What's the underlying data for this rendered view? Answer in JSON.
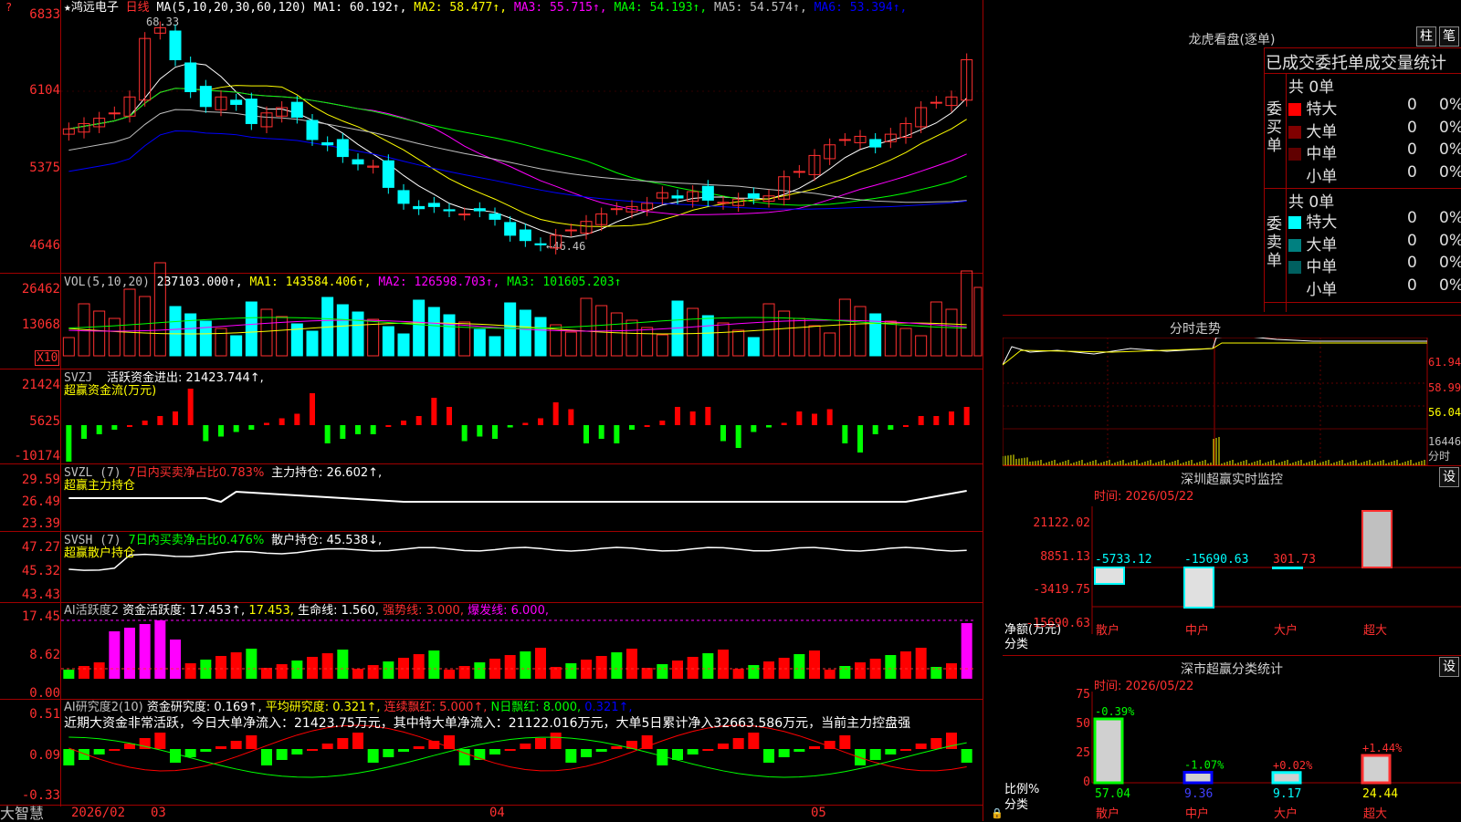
{
  "stock": {
    "name": "鸿远电子",
    "period": "日线",
    "star": "★"
  },
  "topbar": {
    "ma_label": "MA(5,10,20,30,60,120)",
    "ma": [
      {
        "name": "MA1:",
        "value": "60.192↑",
        "color": "#ffffff"
      },
      {
        "name": "MA2:",
        "value": "58.477↑",
        "color": "#ffff00"
      },
      {
        "name": "MA3:",
        "value": "55.715↑",
        "color": "#ff00ff"
      },
      {
        "name": "MA4:",
        "value": "54.193↑",
        "color": "#00ff00"
      },
      {
        "name": "MA5:",
        "value": "54.574↑",
        "color": "#c0c0c0"
      },
      {
        "name": "MA6:",
        "value": "53.394↑",
        "color": "#0000ff"
      }
    ]
  },
  "price_axis": [
    "6833",
    "6104",
    "5375",
    "4646"
  ],
  "price_marks": {
    "high": "68.33",
    "low": "46.46"
  },
  "vol_panel": {
    "label": "VOL(5,10,20)",
    "value": "237103.000↑,",
    "ma1": "MA1: 143584.406↑,",
    "ma2": "MA2: 126598.703↑,",
    "ma3": "MA3: 101605.203↑",
    "axis": [
      "26462",
      "13068"
    ],
    "unit": "X10"
  },
  "svzj": {
    "label": "SVZJ",
    "text": "活跃资金进出: 21423.744↑,",
    "sub": "超赢资金流(万元)",
    "axis": [
      "21424",
      "5625",
      "-10174"
    ]
  },
  "svzl": {
    "label": "SVZL (7)",
    "text": "7日内买卖净占比0.783%",
    "text2": "主力持仓: 26.602↑,",
    "sub": "超赢主力持仓",
    "axis": [
      "29.59",
      "26.49",
      "23.39"
    ]
  },
  "svsh": {
    "label": "SVSH (7)",
    "text": "7日内买卖净占比0.476%",
    "text2": "散户持仓: 45.538↓,",
    "sub": "超赢散户持仓",
    "axis": [
      "47.27",
      "45.32",
      "43.43"
    ]
  },
  "ai_active": {
    "label": "AI活跃度2",
    "t1": "资金活跃度: 17.453↑,",
    "t2": "17.453,",
    "t3": "生命线: 1.560,",
    "t4": "强势线: 3.000,",
    "t5": "爆发线: 6.000,",
    "axis": [
      "17.45",
      "8.62",
      "0.00"
    ]
  },
  "ai_research": {
    "label": "AI研究度2(10)",
    "t1": "资金研究度: 0.169↑,",
    "t2": "平均研究度: 0.321↑,",
    "t3": "连续飘红: 5.000↑,",
    "t4": "N日飘红: 8.000,",
    "t5": "0.321↑,",
    "desc": "近期大资金非常活跃，今日大单净流入：21423.75万元，其中特大单净流入：21122.016万元，大单5日累计净入32663.586万元，当前主力控盘强",
    "axis": [
      "0.51",
      "0.09",
      "-0.33"
    ]
  },
  "bottom": {
    "brand": "大智慧",
    "dates": [
      "2026/02",
      "03",
      "04",
      "05"
    ]
  },
  "lhb": {
    "title": "龙虎看盘(逐单)",
    "btn1": "柱",
    "btn2": "笔",
    "header": "已成交委托单成交量统计",
    "buy_label": "委买单",
    "buy_total": "共 0单",
    "buy_rows": [
      {
        "name": "特大",
        "v": "0",
        "p": "0%",
        "color": "#ff0000"
      },
      {
        "name": "大单",
        "v": "0",
        "p": "0%",
        "color": "#800000"
      },
      {
        "name": "中单",
        "v": "0",
        "p": "0%",
        "color": "#600000"
      },
      {
        "name": "小单",
        "v": "0",
        "p": "0%",
        "color": "#000000"
      }
    ],
    "sell_label": "委卖单",
    "sell_total": "共 0单",
    "sell_rows": [
      {
        "name": "特大",
        "v": "0",
        "p": "0%",
        "color": "#00ffff"
      },
      {
        "name": "大单",
        "v": "0",
        "p": "0%",
        "color": "#008080"
      },
      {
        "name": "中单",
        "v": "0",
        "p": "0%",
        "color": "#006060"
      },
      {
        "name": "小单",
        "v": "0",
        "p": "0%",
        "color": "#000000"
      }
    ]
  },
  "fenshi": {
    "title": "分时走势",
    "axis": [
      "61.94",
      "58.99",
      "56.04",
      "16446"
    ],
    "unit": "分时"
  },
  "sz_monitor": {
    "title": "深圳超赢实时监控",
    "btn": "设",
    "time": "时间: 2026/05/22",
    "axis": [
      "21122.02",
      "8851.13",
      "-3419.75",
      "-15690.63"
    ],
    "ylabel": "净额(万元)",
    "xlabel": "分类",
    "cats": [
      "散户",
      "中户",
      "大户",
      "超大"
    ],
    "vals": [
      "-5733.12",
      "-15690.63",
      "301.73",
      "21122.02"
    ]
  },
  "sz_class": {
    "title": "深市超赢分类统计",
    "btn": "设",
    "time": "时间: 2026/05/22",
    "axis": [
      "75",
      "50",
      "25",
      "0"
    ],
    "ylabel": "比例%",
    "xlabel": "分类",
    "cats": [
      "散户",
      "中户",
      "大户",
      "超大"
    ],
    "pct": [
      "57.04",
      "9.36",
      "9.17",
      "24.44"
    ],
    "chg": [
      "-0.39%",
      "-1.07%",
      "+0.02%",
      "+1.44%"
    ]
  },
  "chart_data": {
    "type": "candlestick",
    "title": "鸿远电子 日线",
    "ylim": [
      46.46,
      68.33
    ]
  }
}
